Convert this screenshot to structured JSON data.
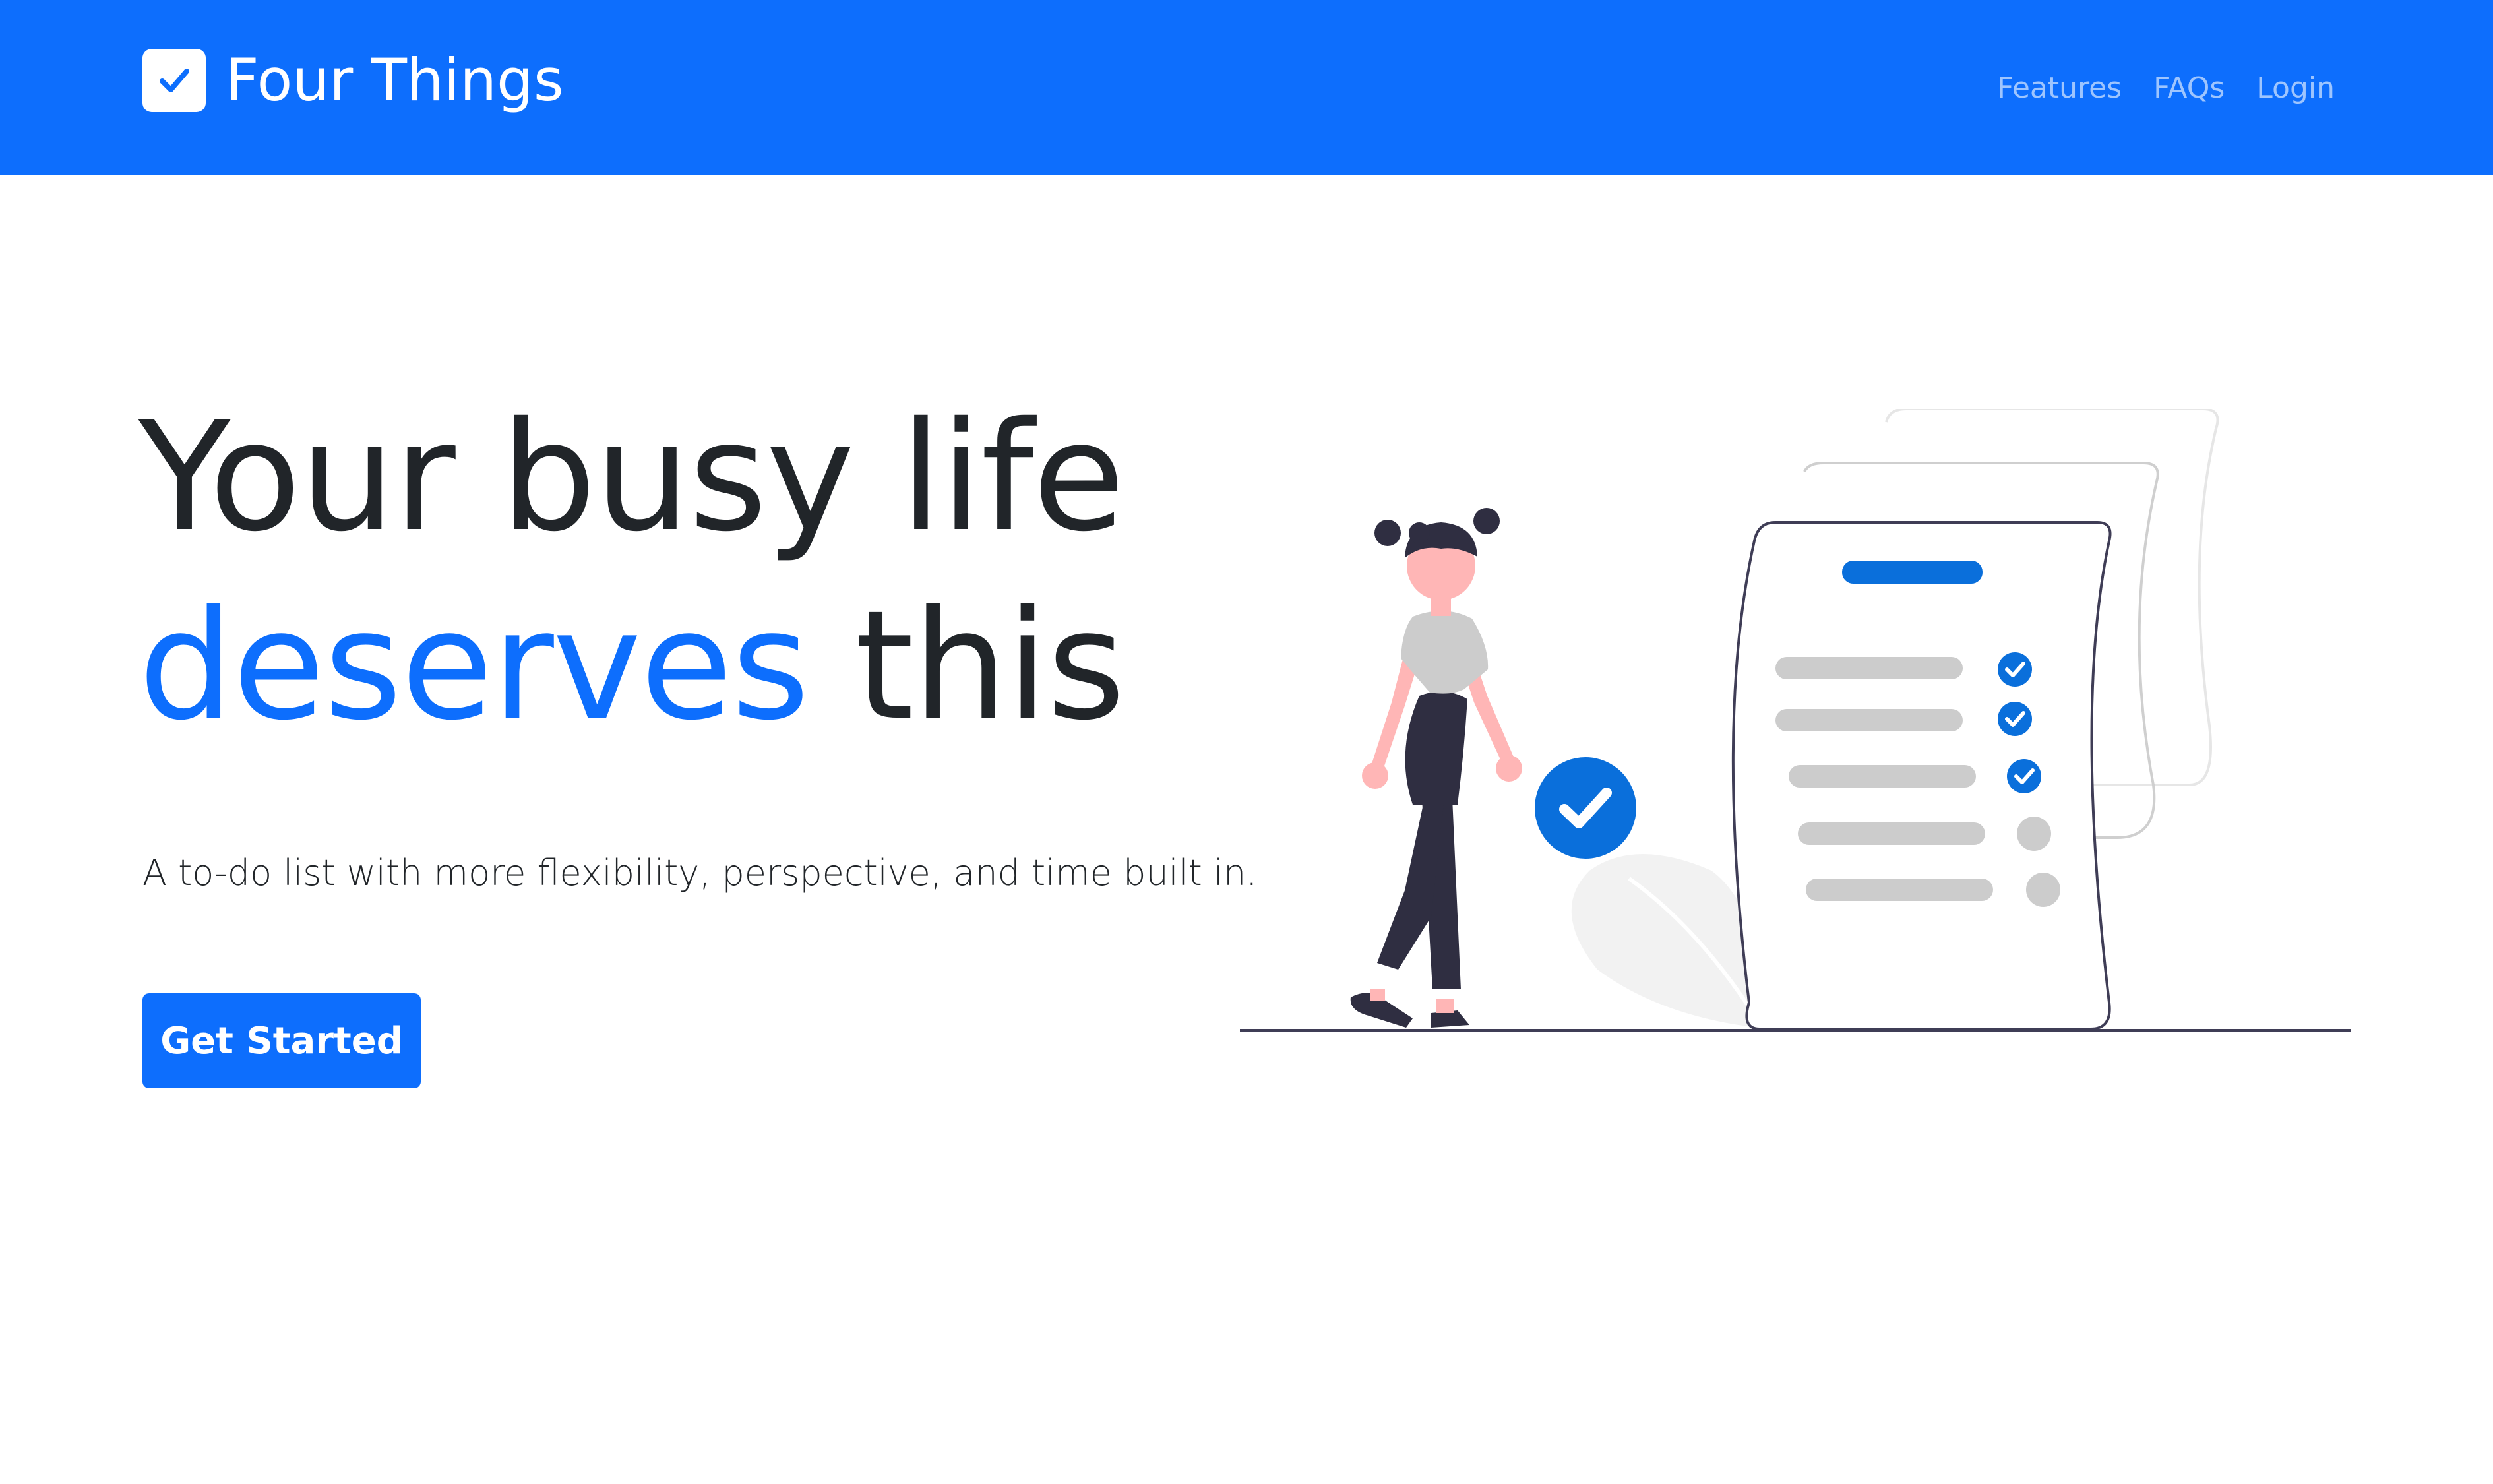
{
  "nav": {
    "brand": "Four Things",
    "links": [
      "Features",
      "FAQs",
      "Login"
    ]
  },
  "hero": {
    "title_line1": "Your busy life",
    "title_accent": "deserves",
    "title_rest": " this",
    "subtitle": "A to-do list with more flexibility, perspective, and time built in.",
    "cta_label": "Get Started"
  },
  "illustration": {
    "checklist_items": [
      {
        "checked": true
      },
      {
        "checked": true
      },
      {
        "checked": true
      },
      {
        "checked": false
      },
      {
        "checked": false
      }
    ]
  },
  "colors": {
    "primary": "#0d6efd",
    "text": "#212529",
    "illustration_check": "#0a6fdb",
    "illustration_gray": "#cccccc",
    "skin": "#ffb6b6",
    "dark": "#2f2e41"
  },
  "icons": {
    "brand": "check-square-icon"
  }
}
